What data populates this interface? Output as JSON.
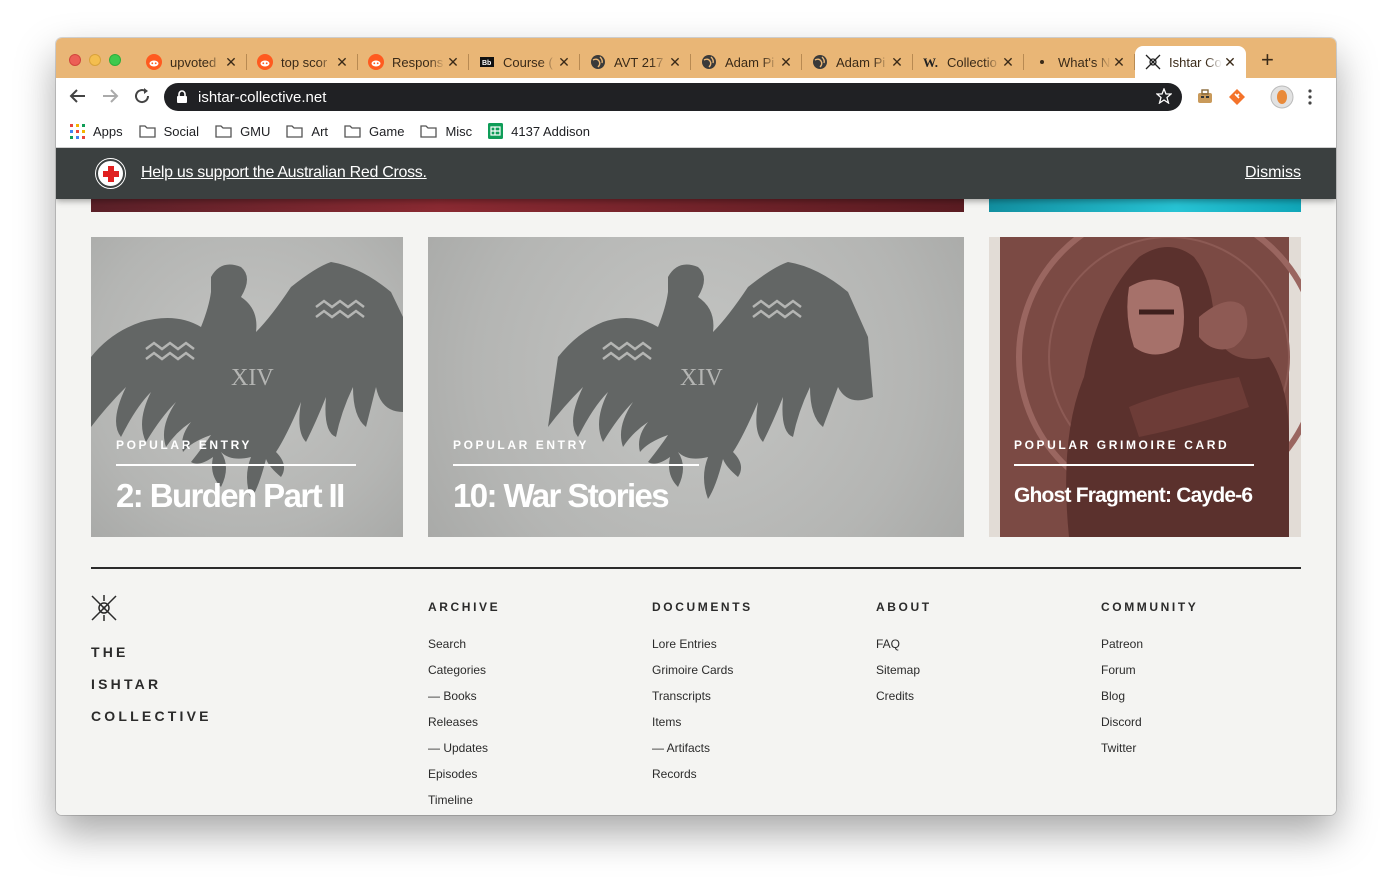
{
  "browser": {
    "tabs": [
      {
        "title": "upvoted",
        "icon": "reddit-icon"
      },
      {
        "title": "top scor",
        "icon": "reddit-icon"
      },
      {
        "title": "Respons",
        "icon": "reddit-icon"
      },
      {
        "title": "Course (",
        "icon": "blackboard-icon"
      },
      {
        "title": "AVT 217",
        "icon": "globe-icon"
      },
      {
        "title": "Adam Pi",
        "icon": "globe-icon"
      },
      {
        "title": "Adam Pi",
        "icon": "globe-icon"
      },
      {
        "title": "Collectio",
        "icon": "w-icon"
      },
      {
        "title": "What's N",
        "icon": "dot-icon"
      },
      {
        "title": "Ishtar Co",
        "icon": "ishtar-icon",
        "active": true
      }
    ],
    "url": "ishtar-collective.net",
    "bookmarks": [
      {
        "label": "Apps",
        "icon": "apps-grid-icon"
      },
      {
        "label": "Social",
        "icon": "folder-icon"
      },
      {
        "label": "GMU",
        "icon": "folder-icon"
      },
      {
        "label": "Art",
        "icon": "folder-icon"
      },
      {
        "label": "Game",
        "icon": "folder-icon"
      },
      {
        "label": "Misc",
        "icon": "folder-icon"
      },
      {
        "label": "4137 Addison",
        "icon": "sheets-icon"
      }
    ],
    "theme_color": "#e9b676"
  },
  "banner": {
    "message": "Help us support the Australian Red Cross.",
    "dismiss": "Dismiss"
  },
  "cards": [
    {
      "kicker": "POPULAR ENTRY",
      "title": "2: Burden Part II"
    },
    {
      "kicker": "POPULAR ENTRY",
      "title": "10: War Stories"
    },
    {
      "kicker": "POPULAR GRIMOIRE CARD",
      "title": "Ghost Fragment: Cayde-6"
    }
  ],
  "footer": {
    "brand": [
      "THE",
      "ISHTAR",
      "COLLECTIVE"
    ],
    "columns": [
      {
        "heading": "ARCHIVE",
        "items": [
          "Search",
          "Categories",
          "— Books",
          "Releases",
          "— Updates",
          "Episodes",
          "Timeline"
        ]
      },
      {
        "heading": "DOCUMENTS",
        "items": [
          "Lore Entries",
          "Grimoire Cards",
          "Transcripts",
          "Items",
          "— Artifacts",
          "Records"
        ]
      },
      {
        "heading": "ABOUT",
        "items": [
          "FAQ",
          "Sitemap",
          "Credits"
        ]
      },
      {
        "heading": "COMMUNITY",
        "items": [
          "Patreon",
          "Forum",
          "Blog",
          "Discord",
          "Twitter"
        ]
      }
    ]
  },
  "emblem_numeral": "XIV"
}
